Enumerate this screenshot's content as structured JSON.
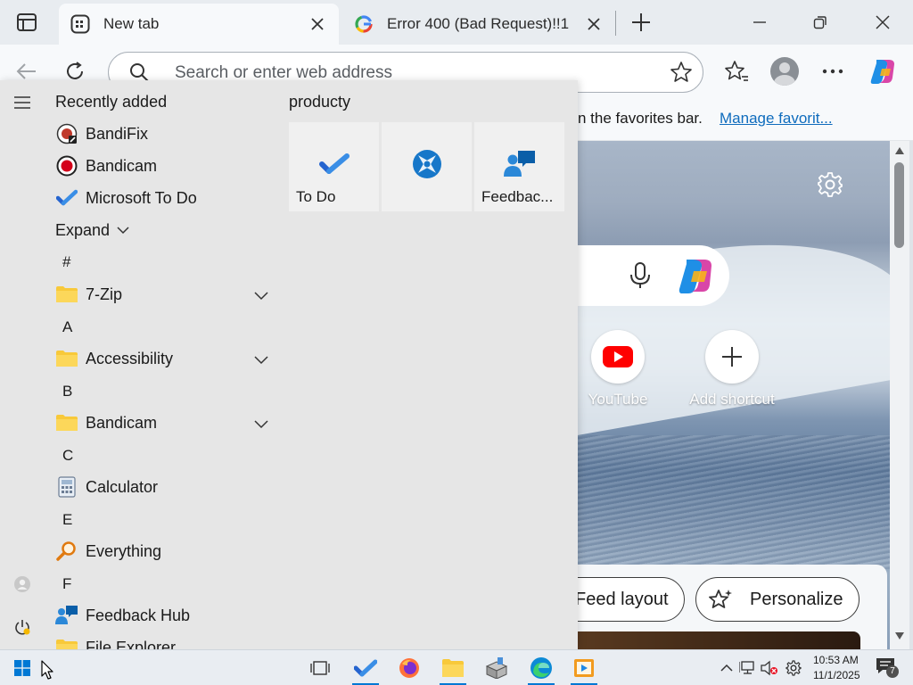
{
  "browser": {
    "tabs": [
      {
        "title": "New tab",
        "icon": "new-tab-page-icon",
        "active": true
      },
      {
        "title": "Error 400 (Bad Request)!!1",
        "icon": "google-g-icon",
        "active": false
      }
    ],
    "address_placeholder": "Search or enter web address",
    "favorites_bar": {
      "message_fragment": "n the favorites bar.",
      "manage_link": "Manage favorit..."
    }
  },
  "new_tab_page": {
    "shortcuts": [
      {
        "label": "YouTube",
        "icon": "youtube-icon"
      },
      {
        "label": "Add shortcut",
        "icon": "plus-icon"
      }
    ],
    "feed_layout_label": "Feed layout",
    "personalize_label": "Personalize"
  },
  "start_menu": {
    "recently_added_title": "Recently added",
    "recent_apps": [
      {
        "label": "BandiFix",
        "icon": "bandifix-icon"
      },
      {
        "label": "Bandicam",
        "icon": "bandicam-icon"
      },
      {
        "label": "Microsoft To Do",
        "icon": "todo-check-icon"
      }
    ],
    "expand_label": "Expand",
    "letters": {
      "hash": "#",
      "a": "A",
      "b": "B",
      "c": "C",
      "e": "E",
      "f": "F"
    },
    "apps": {
      "seven_zip": "7-Zip",
      "accessibility": "Accessibility",
      "bandicam_folder": "Bandicam",
      "calculator": "Calculator",
      "everything": "Everything",
      "feedback_hub": "Feedback Hub",
      "file_explorer": "File Explorer"
    },
    "tiles_group_title": "producty",
    "tiles": [
      {
        "label": "To Do",
        "icon": "todo-check-icon"
      },
      {
        "label": "",
        "icon": "compass-app-icon"
      },
      {
        "label": "Feedbac...",
        "icon": "feedback-hub-icon"
      }
    ]
  },
  "taskbar": {
    "clock_time": "10:53 AM",
    "clock_date": "11/1/2025",
    "notification_count": "7"
  },
  "colors": {
    "accent": "#0078d4",
    "link": "#0f6cbd",
    "start_menu_bg": "#e6e6e6"
  }
}
